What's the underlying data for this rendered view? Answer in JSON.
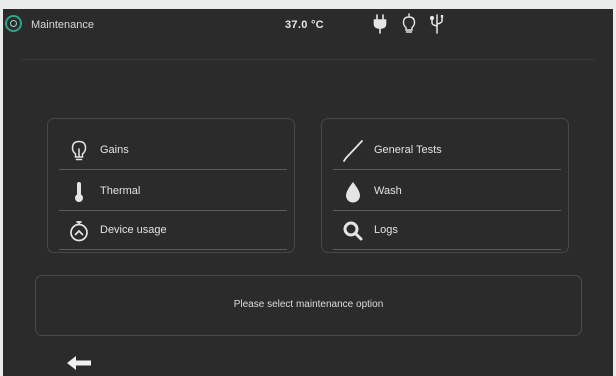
{
  "header": {
    "title": "Maintenance",
    "temperature": "37.0 °C",
    "status_icons": [
      "plug-icon",
      "bulb-icon",
      "usb-icon"
    ]
  },
  "menu_left": [
    {
      "label": "Gains",
      "icon": "bulb-icon"
    },
    {
      "label": "Thermal",
      "icon": "thermometer-icon"
    },
    {
      "label": "Device usage",
      "icon": "stopwatch-icon"
    }
  ],
  "menu_right": [
    {
      "label": "General Tests",
      "icon": "probe-icon"
    },
    {
      "label": "Wash",
      "icon": "drop-icon"
    },
    {
      "label": "Logs",
      "icon": "magnifier-icon"
    }
  ],
  "message": "Please select maintenance option",
  "colors": {
    "background": "#2b2b2b",
    "accent": "#2fa38d",
    "text": "#e2e2e2"
  }
}
